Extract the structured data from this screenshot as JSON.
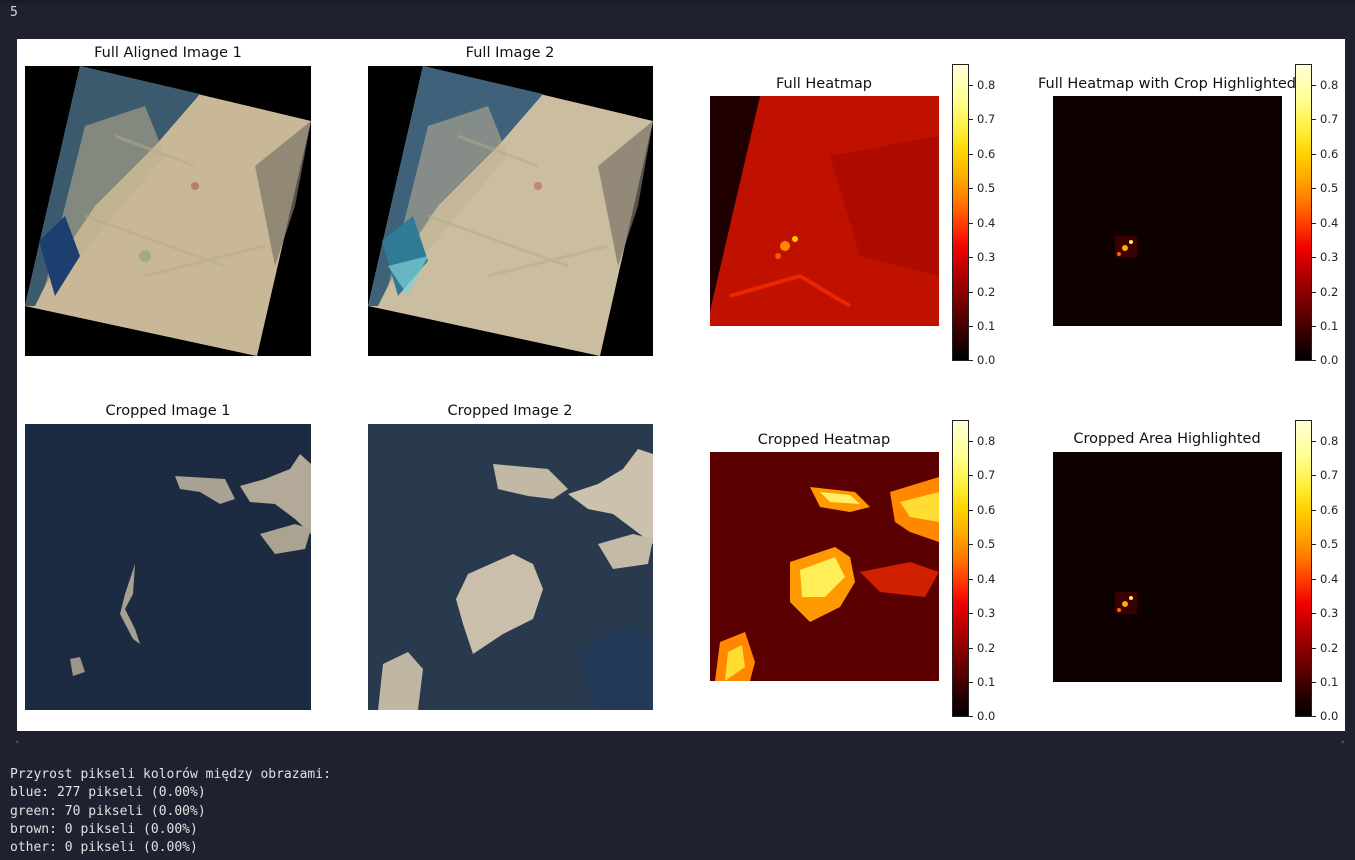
{
  "cell": {
    "execution_count": "5"
  },
  "figure": {
    "panels": [
      {
        "id": "full-aligned-image-1",
        "title": "Full Aligned Image 1"
      },
      {
        "id": "full-image-2",
        "title": "Full Image 2"
      },
      {
        "id": "full-heatmap",
        "title": "Full Heatmap"
      },
      {
        "id": "full-heatmap-crop",
        "title": "Full Heatmap with Crop Highlighted"
      },
      {
        "id": "cropped-image-1",
        "title": "Cropped Image 1"
      },
      {
        "id": "cropped-image-2",
        "title": "Cropped Image 2"
      },
      {
        "id": "cropped-heatmap",
        "title": "Cropped Heatmap"
      },
      {
        "id": "cropped-area-highlighted",
        "title": "Cropped Area Highlighted"
      }
    ],
    "colorbar": {
      "colormap": "hot",
      "min": 0.0,
      "max": 0.86,
      "ticks": [
        "0.8",
        "0.7",
        "0.6",
        "0.5",
        "0.4",
        "0.3",
        "0.2",
        "0.1",
        "0.0"
      ],
      "tick_values": [
        0.8,
        0.7,
        0.6,
        0.5,
        0.4,
        0.3,
        0.2,
        0.1,
        0.0
      ]
    }
  },
  "output": {
    "header": "Przyrost pikseli kolorów między obrazami:",
    "lines": [
      "blue: 277 pikseli (0.00%)",
      "green: 70 pikseli (0.00%)",
      "brown: 0 pikseli (0.00%)",
      "other: 0 pikseli (0.00%)"
    ]
  },
  "colors": {
    "background": "#1f2030",
    "figure_bg": "#ffffff",
    "text": "#e2e2e2"
  }
}
